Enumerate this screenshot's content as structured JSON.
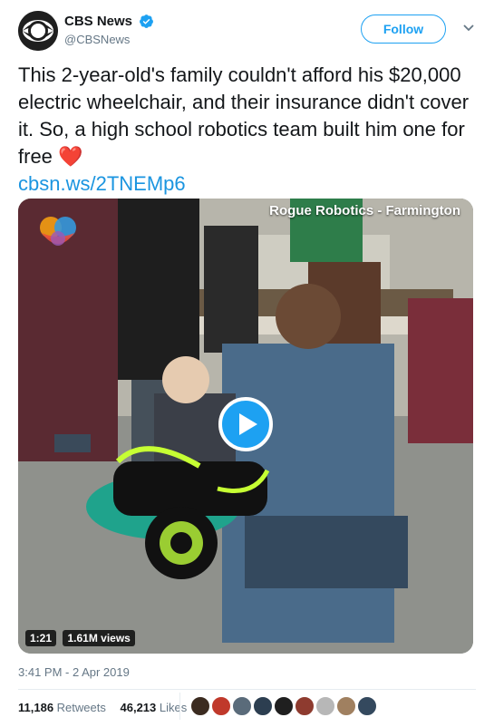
{
  "tweet": {
    "author": {
      "display_name": "CBS News",
      "handle": "@CBSNews",
      "verified": true
    },
    "follow_label": "Follow",
    "text": "This 2-year-old's family couldn't afford his $20,000 electric wheelchair, and their insurance didn't cover it. So, a high school robotics team built him one for free",
    "emoji": "❤️",
    "link": "cbsn.ws/2TNEMp6",
    "timestamp": "3:41 PM - 2 Apr 2019"
  },
  "media": {
    "watermark": "Rogue Robotics - Farmington",
    "duration": "1:21",
    "views": "1.61M views"
  },
  "stats": {
    "retweets_count": "11,186",
    "retweets_label": "Retweets",
    "likes_count": "46,213",
    "likes_label": "Likes"
  },
  "likers": [
    {
      "name": "liker-1",
      "color": "#3b2b20"
    },
    {
      "name": "liker-2",
      "color": "#c0392b"
    },
    {
      "name": "liker-3",
      "color": "#5a6b7a"
    },
    {
      "name": "liker-4",
      "color": "#2c3e50"
    },
    {
      "name": "liker-5",
      "color": "#1f1f1f"
    },
    {
      "name": "liker-6",
      "color": "#8e3b2f"
    },
    {
      "name": "liker-7",
      "color": "#b7b7b7"
    },
    {
      "name": "liker-8",
      "color": "#a08060"
    },
    {
      "name": "liker-9",
      "color": "#34495e"
    }
  ],
  "colors": {
    "accent": "#1da1f2",
    "link": "#1b95e0",
    "heart": "#e0245e",
    "muted": "#657786"
  }
}
